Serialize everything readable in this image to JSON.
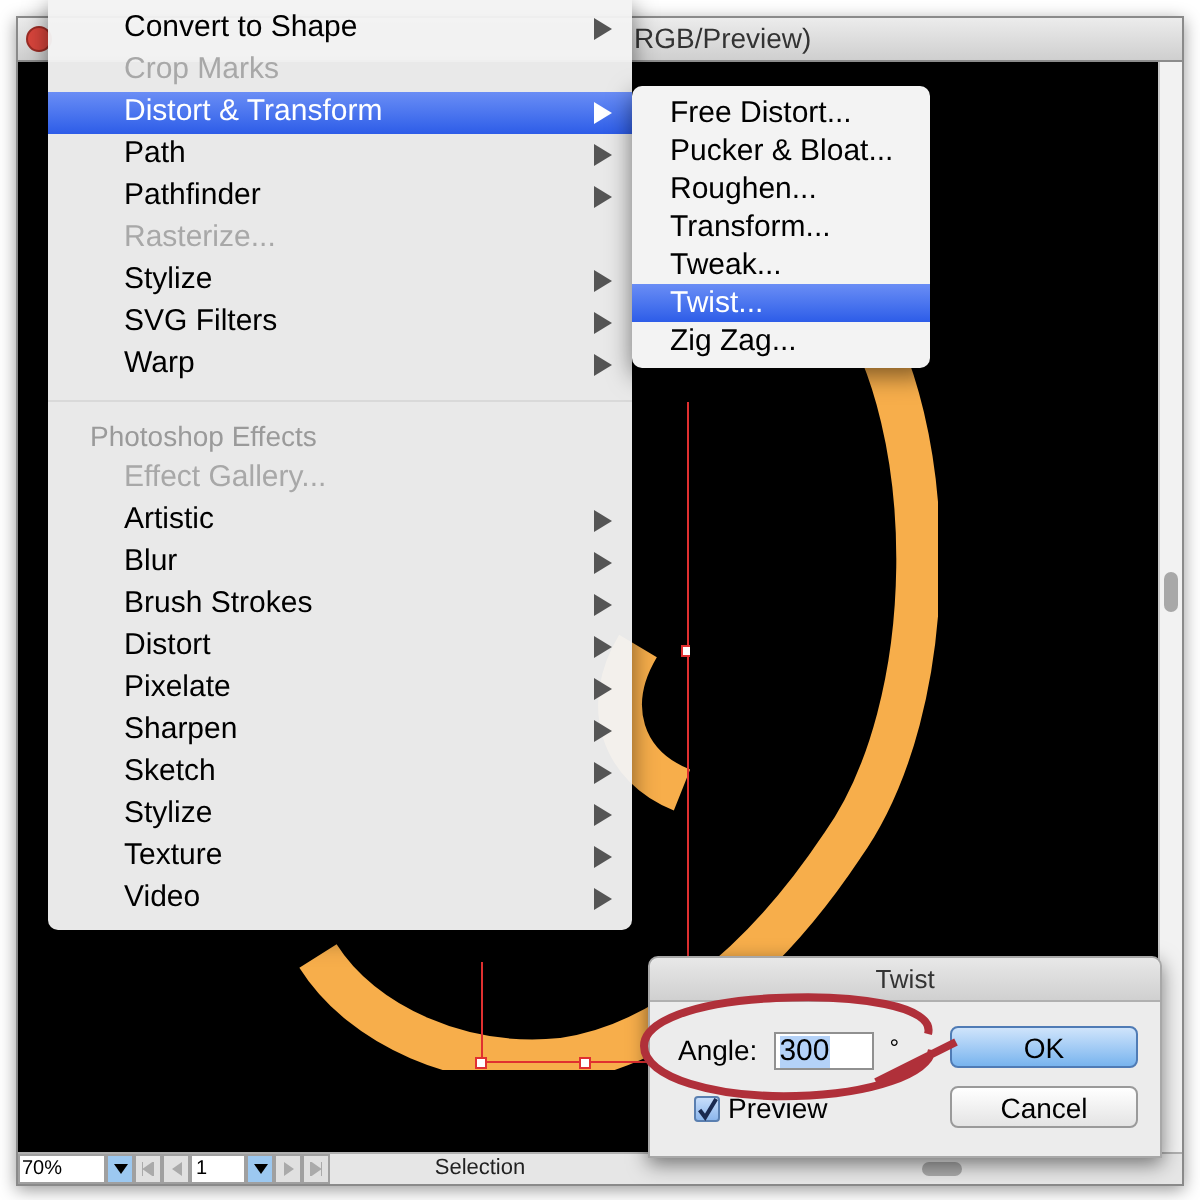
{
  "window": {
    "title": "RGB/Preview)"
  },
  "menu": {
    "items": [
      {
        "kind": "item",
        "label": "Convert to Shape",
        "disabled": false,
        "selected": false,
        "submenu": true
      },
      {
        "kind": "item",
        "label": "Crop Marks",
        "disabled": true,
        "selected": false,
        "submenu": false
      },
      {
        "kind": "item",
        "label": "Distort & Transform",
        "disabled": false,
        "selected": true,
        "submenu": true
      },
      {
        "kind": "item",
        "label": "Path",
        "disabled": false,
        "selected": false,
        "submenu": true
      },
      {
        "kind": "item",
        "label": "Pathfinder",
        "disabled": false,
        "selected": false,
        "submenu": true
      },
      {
        "kind": "item",
        "label": "Rasterize...",
        "disabled": true,
        "selected": false,
        "submenu": false
      },
      {
        "kind": "item",
        "label": "Stylize",
        "disabled": false,
        "selected": false,
        "submenu": true
      },
      {
        "kind": "item",
        "label": "SVG Filters",
        "disabled": false,
        "selected": false,
        "submenu": true
      },
      {
        "kind": "item",
        "label": "Warp",
        "disabled": false,
        "selected": false,
        "submenu": true
      },
      {
        "kind": "separator"
      },
      {
        "kind": "header",
        "label": "Photoshop Effects"
      },
      {
        "kind": "item",
        "label": "Effect Gallery...",
        "disabled": true,
        "selected": false,
        "submenu": false
      },
      {
        "kind": "item",
        "label": "Artistic",
        "disabled": false,
        "selected": false,
        "submenu": true
      },
      {
        "kind": "item",
        "label": "Blur",
        "disabled": false,
        "selected": false,
        "submenu": true
      },
      {
        "kind": "item",
        "label": "Brush Strokes",
        "disabled": false,
        "selected": false,
        "submenu": true
      },
      {
        "kind": "item",
        "label": "Distort",
        "disabled": false,
        "selected": false,
        "submenu": true
      },
      {
        "kind": "item",
        "label": "Pixelate",
        "disabled": false,
        "selected": false,
        "submenu": true
      },
      {
        "kind": "item",
        "label": "Sharpen",
        "disabled": false,
        "selected": false,
        "submenu": true
      },
      {
        "kind": "item",
        "label": "Sketch",
        "disabled": false,
        "selected": false,
        "submenu": true
      },
      {
        "kind": "item",
        "label": "Stylize",
        "disabled": false,
        "selected": false,
        "submenu": true
      },
      {
        "kind": "item",
        "label": "Texture",
        "disabled": false,
        "selected": false,
        "submenu": true
      },
      {
        "kind": "item",
        "label": "Video",
        "disabled": false,
        "selected": false,
        "submenu": true
      }
    ]
  },
  "submenu": {
    "items": [
      {
        "label": "Free Distort...",
        "selected": false
      },
      {
        "label": "Pucker & Bloat...",
        "selected": false
      },
      {
        "label": "Roughen...",
        "selected": false
      },
      {
        "label": "Transform...",
        "selected": false
      },
      {
        "label": "Tweak...",
        "selected": false
      },
      {
        "label": "Twist...",
        "selected": true
      },
      {
        "label": "Zig Zag...",
        "selected": false
      }
    ]
  },
  "dialog": {
    "title": "Twist",
    "angle": {
      "label": "Angle:",
      "value": "300",
      "unit": "°"
    },
    "preview": {
      "label": "Preview",
      "checked": true
    },
    "buttons": [
      {
        "label": "OK",
        "default": true
      },
      {
        "label": "Cancel",
        "default": false
      }
    ]
  },
  "status_bar": {
    "zoom": "70%",
    "page": "1",
    "tool": "Selection"
  }
}
